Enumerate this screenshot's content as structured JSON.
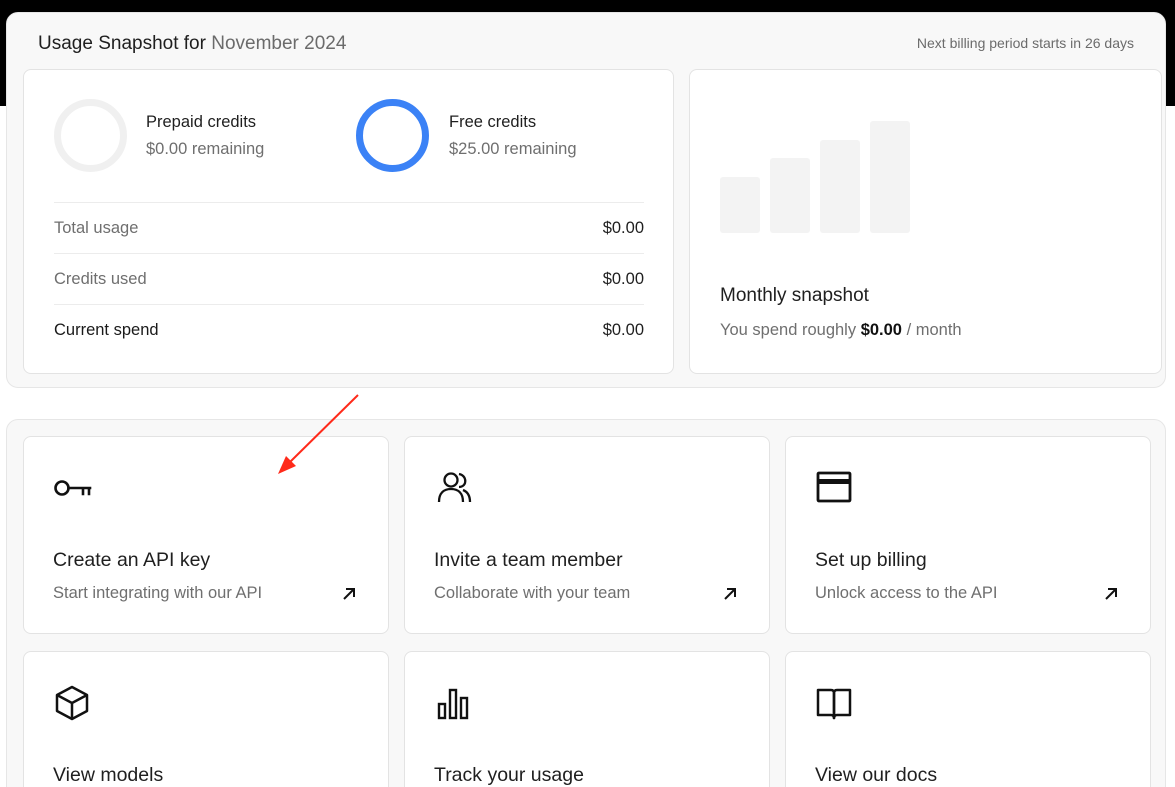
{
  "snapshot": {
    "title_prefix": "Usage Snapshot for",
    "month": "November 2024",
    "billing_note": "Next billing period starts in 26 days",
    "credits": [
      {
        "name": "Prepaid credits",
        "remaining": "$0.00 remaining",
        "ring_color": "#f0f0f0"
      },
      {
        "name": "Free credits",
        "remaining": "$25.00 remaining",
        "ring_color": "#3b82f6"
      }
    ],
    "rows": [
      {
        "label": "Total usage",
        "value": "$0.00"
      },
      {
        "label": "Credits used",
        "value": "$0.00"
      },
      {
        "label": "Current spend",
        "value": "$0.00"
      }
    ],
    "monthly": {
      "title": "Monthly snapshot",
      "prefix": "You spend roughly",
      "amount": "$0.00",
      "suffix": "/ month"
    }
  },
  "actions": [
    {
      "title": "Create an API key",
      "subtitle": "Start integrating with our API",
      "icon": "key-icon"
    },
    {
      "title": "Invite a team member",
      "subtitle": "Collaborate with your team",
      "icon": "users-icon"
    },
    {
      "title": "Set up billing",
      "subtitle": "Unlock access to the API",
      "icon": "credit-card-icon"
    },
    {
      "title": "View models",
      "subtitle": "",
      "icon": "cube-icon"
    },
    {
      "title": "Track your usage",
      "subtitle": "",
      "icon": "bar-chart-icon"
    },
    {
      "title": "View our docs",
      "subtitle": "",
      "icon": "book-icon"
    }
  ],
  "colors": {
    "accent": "#3b82f6",
    "annotation": "#ff2a1a"
  }
}
